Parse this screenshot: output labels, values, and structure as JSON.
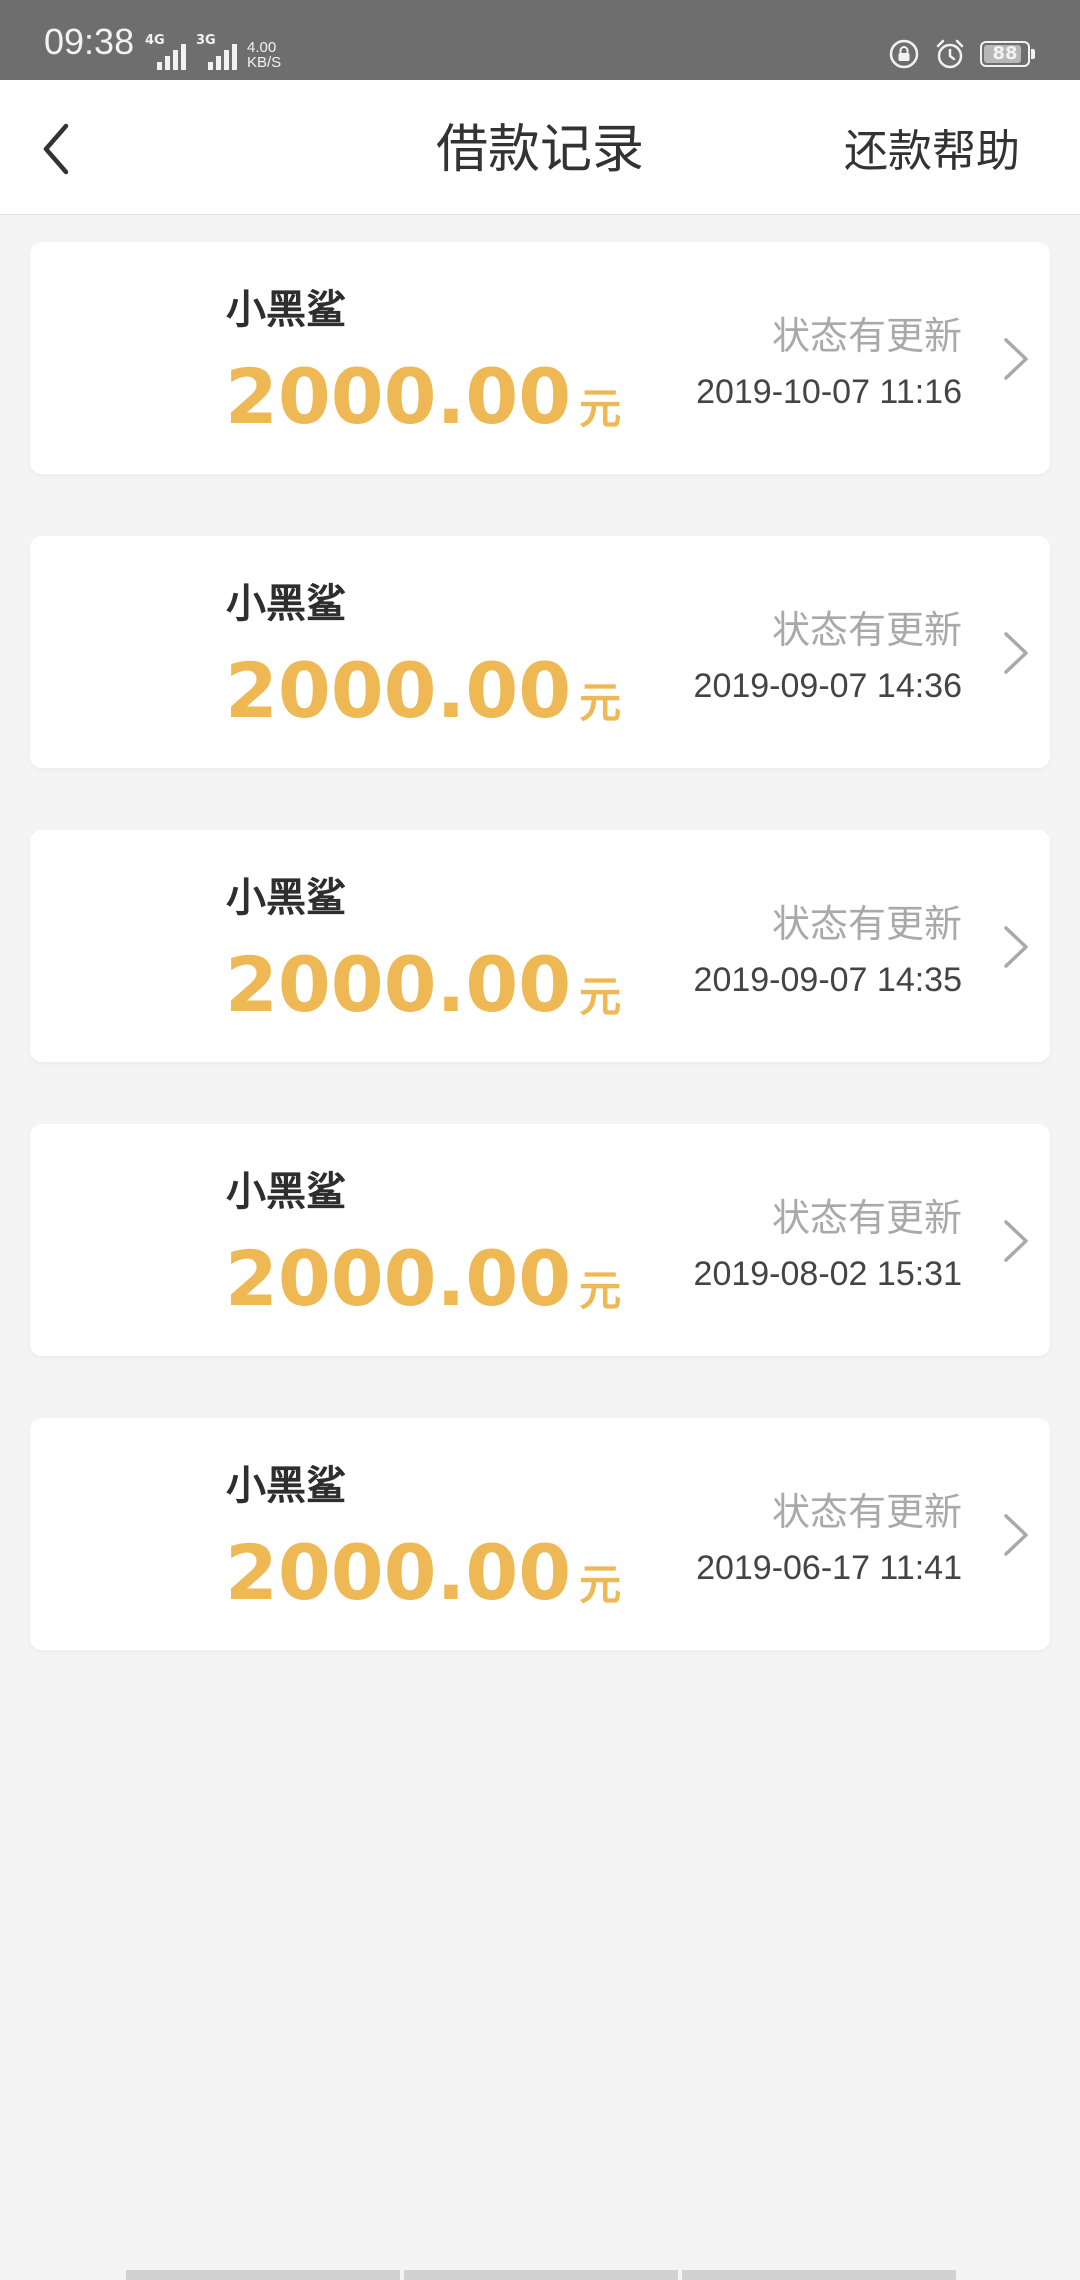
{
  "status_bar": {
    "time": "09:38",
    "signal_1_tech": "4G",
    "signal_2_tech": "3G",
    "net_speed_value": "4.00",
    "net_speed_unit": "KB/S",
    "battery_level": "88",
    "battery_fraction": 0.88
  },
  "header": {
    "title": "借款记录",
    "help_label": "还款帮助",
    "back_icon": "chevron-left-icon"
  },
  "records": [
    {
      "lender": "小黑鲨",
      "amount": "2000.00",
      "unit": "元",
      "status": "状态有更新",
      "date": "2019-10-07 11:16"
    },
    {
      "lender": "小黑鲨",
      "amount": "2000.00",
      "unit": "元",
      "status": "状态有更新",
      "date": "2019-09-07 14:36"
    },
    {
      "lender": "小黑鲨",
      "amount": "2000.00",
      "unit": "元",
      "status": "状态有更新",
      "date": "2019-09-07 14:35"
    },
    {
      "lender": "小黑鲨",
      "amount": "2000.00",
      "unit": "元",
      "status": "状态有更新",
      "date": "2019-08-02 15:31"
    },
    {
      "lender": "小黑鲨",
      "amount": "2000.00",
      "unit": "元",
      "status": "状态有更新",
      "date": "2019-06-17 11:41"
    }
  ],
  "colors": {
    "amount": "#eeb955",
    "status": "#a9a9a9",
    "background": "#f4f4f4",
    "status_bar": "#6e6e6e"
  }
}
